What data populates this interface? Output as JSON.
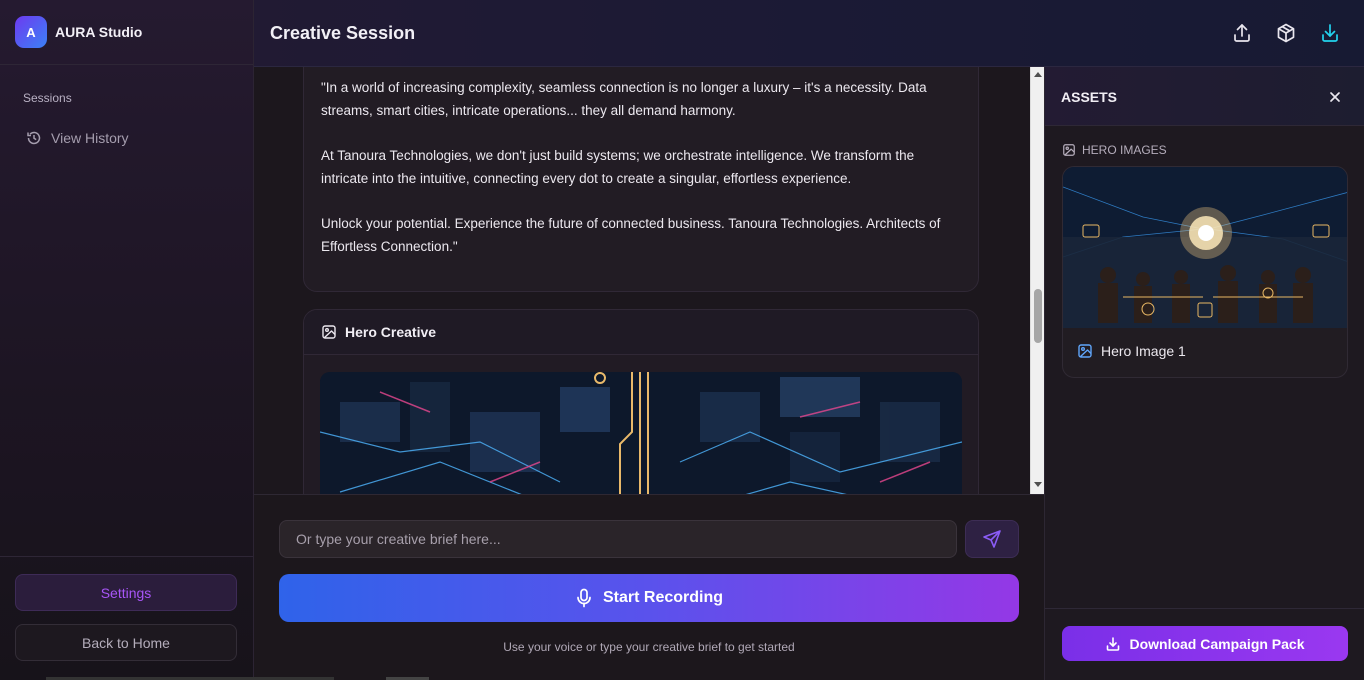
{
  "app": {
    "logo_letter": "A",
    "name": "AURA Studio"
  },
  "sidebar": {
    "sessions_label": "Sessions",
    "history_label": "View History",
    "settings_label": "Settings",
    "home_label": "Back to Home"
  },
  "header": {
    "title": "Creative Session",
    "icons": [
      "upload-icon",
      "package-icon",
      "download-icon"
    ]
  },
  "message": {
    "paragraphs": [
      "\"In a world of increasing complexity, seamless connection is no longer a luxury – it's a necessity. Data streams, smart cities, intricate operations... they all demand harmony.",
      "At Tanoura Technologies, we don't just build systems; we orchestrate intelligence. We transform the intricate into the intuitive, connecting every dot to create a singular, effortless experience.",
      "Unlock your potential. Experience the future of connected business. Tanoura Technologies. Architects of Effortless Connection.\""
    ]
  },
  "hero": {
    "title": "Hero Creative"
  },
  "composer": {
    "placeholder": "Or type your creative brief here...",
    "record_label": "Start Recording",
    "hint": "Use your voice or type your creative brief to get started"
  },
  "assets": {
    "title": "ASSETS",
    "section_label": "HERO IMAGES",
    "items": [
      {
        "name": "Hero Image 1"
      }
    ],
    "download_label": "Download Campaign Pack"
  },
  "colors": {
    "accent_purple": "#a855f7",
    "record_gradient_start": "#2f63ea",
    "record_gradient_end": "#9438e6",
    "download_accent": "#22d3ee"
  }
}
